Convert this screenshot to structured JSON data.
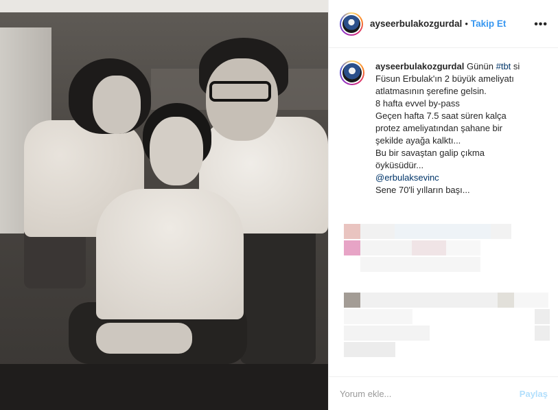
{
  "header": {
    "username": "ayseerbulakozgurdal",
    "separator": "•",
    "follow_label": "Takip Et",
    "more_icon": "more-horizontal-icon"
  },
  "caption": {
    "username": "ayseerbulakozgurdal",
    "lines": [
      "Günün ",
      "Füsun Erbulak'ın 2 büyük ameliyatı",
      "atlatmasının şerefine gelsin.",
      "8 hafta evvel by-pass",
      "Geçen hafta 7.5 saat süren kalça",
      "protez ameliyatından şahane bir",
      "şekilde ayağa kalktı...",
      "Bu bir savaştan galip çıkma",
      "öyküsüdür...",
      "@erbulaksevinc",
      "Sene 70'li yılların başı..."
    ],
    "hashtag": "#tbt",
    "after_hashtag": " si"
  },
  "comment_box": {
    "placeholder": "Yorum ekle...",
    "share_label": "Paylaş"
  },
  "colors": {
    "link": "#003569",
    "follow": "#3897f0",
    "share_disabled": "#b2dffc"
  }
}
